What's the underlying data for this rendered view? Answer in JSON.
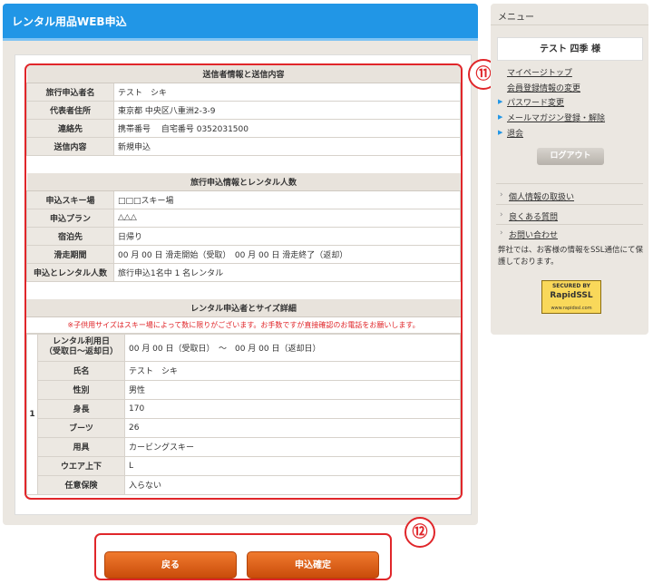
{
  "page_title": "レンタル用品WEB申込",
  "sender": {
    "title": "送信者情報と送信内容",
    "rows": [
      {
        "label": "旅行申込者名",
        "value": "テスト　シキ"
      },
      {
        "label": "代表者住所",
        "value": "東京都 中央区八重洲2-3-9"
      },
      {
        "label": "連絡先",
        "value": "携帯番号　 自宅番号 0352031500"
      },
      {
        "label": "送信内容",
        "value": "新規申込"
      }
    ]
  },
  "trip": {
    "title": "旅行申込情報とレンタル人数",
    "rows": [
      {
        "label": "申込スキー場",
        "value": "□□□スキー場"
      },
      {
        "label": "申込プラン",
        "value": "△△△"
      },
      {
        "label": "宿泊先",
        "value": "日帰り"
      },
      {
        "label": "滑走期間",
        "value": "00 月 00 日 滑走開始（受取）　00 月 00 日 滑走終了（返却）"
      },
      {
        "label": "申込とレンタル人数",
        "value": "旅行申込1名中 1 名レンタル"
      }
    ]
  },
  "rental": {
    "title": "レンタル申込者とサイズ詳細",
    "note": "※子供用サイズはスキー場によって数に限りがございます。お手数ですが直接確認のお電話をお願いします。",
    "number": "1",
    "rows": [
      {
        "label": "レンタル利用日\n（受取日〜返却日）",
        "value": "00 月 00 日（受取日）　～　00 月 00 日（返却日）"
      },
      {
        "label": "氏名",
        "value": "テスト　シキ"
      },
      {
        "label": "性別",
        "value": "男性"
      },
      {
        "label": "身長",
        "value": "170"
      },
      {
        "label": "ブーツ",
        "value": "26"
      },
      {
        "label": "用具",
        "value": "カービングスキー"
      },
      {
        "label": "ウエア上下",
        "value": "L"
      },
      {
        "label": "任意保険",
        "value": "入らない"
      }
    ]
  },
  "buttons": {
    "back": "戻る",
    "confirm": "申込確定"
  },
  "markers": {
    "eleven": "⑪",
    "twelve": "⑫"
  },
  "sidebar": {
    "title": "メニュー",
    "user": "テスト 四季 様",
    "links": [
      "マイページトップ",
      "会員登録情報の変更",
      "パスワード変更",
      "メールマガジン登録・解除",
      "退会"
    ],
    "logout": "ログアウト",
    "info_links": [
      "個人情報の取扱い",
      "良くある質問",
      "お問い合わせ"
    ],
    "ssl_text": "弊社では、お客様の情報をSSL通信にて保護しております。",
    "ssl_badge": {
      "line1": "SECURED BY",
      "line2": "RapidSSL",
      "line3": "www.rapidssl.com"
    }
  },
  "colors": {
    "header_blue": "#2196e6",
    "highlight_red": "#e0262a",
    "button_orange": "#e0661f"
  }
}
